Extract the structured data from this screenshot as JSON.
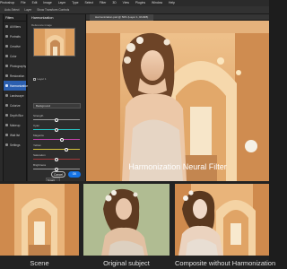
{
  "menubar": {
    "items": [
      "Photoshop",
      "File",
      "Edit",
      "Image",
      "Layer",
      "Type",
      "Select",
      "Filter",
      "3D",
      "View",
      "Plugins",
      "Window",
      "Help"
    ]
  },
  "optbar": {
    "items": [
      "Auto-Select",
      "Layer",
      "Show Transform Controls"
    ]
  },
  "nav_panel": {
    "title": "Filters",
    "items": [
      {
        "label": "All filters",
        "active": false
      },
      {
        "label": "Portraits",
        "active": false
      },
      {
        "label": "Creative",
        "active": false
      },
      {
        "label": "Color",
        "active": false
      },
      {
        "label": "Photography",
        "active": false
      },
      {
        "label": "Restoration",
        "active": false
      },
      {
        "label": "Harmonization",
        "active": true
      },
      {
        "label": "Landscape",
        "active": false
      },
      {
        "label": "Colorize",
        "active": false
      },
      {
        "label": "Depth Blur",
        "active": false
      },
      {
        "label": "Makeup",
        "active": false
      },
      {
        "label": "Wait list",
        "active": false
      },
      {
        "label": "Settings",
        "active": false
      }
    ]
  },
  "filter_panel": {
    "title": "Harmonization",
    "reference_label": "Reference image",
    "layer_checkbox": "Layer 1",
    "select_value": "Background",
    "sliders": [
      {
        "label": "Strength",
        "value": 50,
        "color": "#9a9a9a"
      },
      {
        "label": "Cyan",
        "value": 50,
        "color": "#27c3c3"
      },
      {
        "label": "Magenta",
        "value": 62,
        "color": "#c040a8"
      },
      {
        "label": "Yellow",
        "value": 72,
        "color": "#d6c23a"
      },
      {
        "label": "Saturation",
        "value": 50,
        "color": "#a33a3a"
      },
      {
        "label": "Brightness",
        "value": 50,
        "color": "#9a9a9a"
      }
    ],
    "output_label": "Output",
    "output_value": "Smart Filter",
    "cancel_label": "Cancel",
    "ok_label": "OK"
  },
  "document": {
    "tab_title": "Harmonization.psd @ 50% (Layer 1, RGB/8)"
  },
  "captions": {
    "main": "Harmonization Neural Filter",
    "scene": "Scene",
    "subject": "Original subject",
    "composite": "Composite without Harmonization"
  },
  "colors": {
    "accent": "#1473e6",
    "active_nav": "#2b5fb0",
    "scene_warm": "#e8b27a",
    "subject_green": "#a9b58a"
  }
}
